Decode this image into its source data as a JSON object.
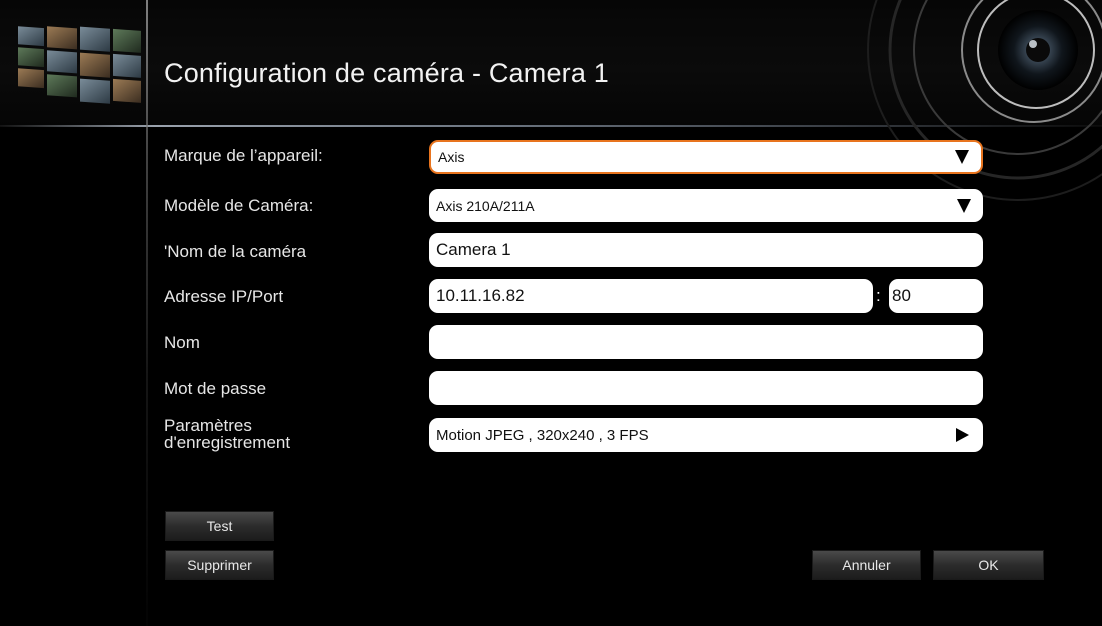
{
  "window": {
    "title": "Configuration de caméra - Camera 1"
  },
  "header": {
    "logo_icon": "camera-thumbnails-icon",
    "lens_icon": "camera-lens-icon"
  },
  "form": {
    "brand": {
      "label": "Marque de l’appareil:",
      "value": "Axis",
      "icon": "chevron-down-icon"
    },
    "model": {
      "label": "Modèle de Caméra:",
      "value": "Axis 210A/211A",
      "icon": "chevron-down-icon"
    },
    "camera_name": {
      "label": "'Nom de la caméra",
      "value": "Camera 1"
    },
    "ip_port": {
      "label": "Adresse IP/Port",
      "ip_value": "10.11.16.82",
      "separator": ":",
      "port_value": "80"
    },
    "username": {
      "label": "Nom",
      "value": ""
    },
    "password": {
      "label": "Mot de passe",
      "value": ""
    },
    "recording": {
      "label_line1": "Paramètres",
      "label_line2": "d'enregistrement",
      "value": "Motion JPEG , 320x240 , 3 FPS",
      "icon": "chevron-right-icon"
    }
  },
  "buttons": {
    "test": "Test",
    "delete": "Supprimer",
    "cancel": "Annuler",
    "ok": "OK"
  },
  "colors": {
    "accent_focus_border": "#e8741e",
    "background": "#000000",
    "field_background": "#ffffff"
  }
}
